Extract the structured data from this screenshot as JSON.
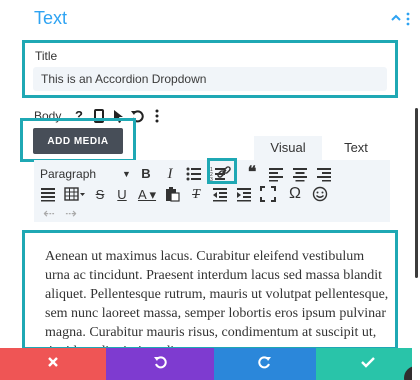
{
  "section": {
    "title": "Text"
  },
  "title_field": {
    "label": "Title",
    "value": "This is an Accordion Dropdown"
  },
  "body_field": {
    "label": "Body",
    "icons": [
      "help-icon",
      "mobile-icon",
      "pointer-icon",
      "reset-icon",
      "more-icon"
    ]
  },
  "add_media": {
    "label": "ADD MEDIA"
  },
  "editor_tabs": {
    "visual": "Visual",
    "text": "Text"
  },
  "toolbar": {
    "paragraph": "Paragraph",
    "row1_icons": [
      "bold-icon",
      "italic-icon",
      "bullet-list-icon",
      "numbered-list-icon",
      "link-icon",
      "blockquote-icon",
      "align-left-icon",
      "align-center-icon",
      "align-right-icon"
    ],
    "row2_icons": [
      "justify-icon",
      "table-icon",
      "strikethrough-icon",
      "underline-icon",
      "text-color-icon",
      "paste-icon",
      "clear-format-icon",
      "outdent-icon",
      "indent-icon",
      "fullscreen-icon",
      "special-char-icon",
      "emoji-icon"
    ],
    "row3_icons": [
      "undo-icon",
      "redo-icon"
    ]
  },
  "content": {
    "text": "Aenean ut maximus lacus. Curabitur eleifend vestibulum urna ac tincidunt. Praesent interdum lacus sed massa blandit aliquet. Pellentesque rutrum, mauris ut volutpat pellentesque, sem nunc laoreet massa, semper lobortis eros ipsum pulvinar magna. Curabitur mauris risus, condimentum at suscipit ut, tincidunt dignissim odio."
  },
  "colors": {
    "accent": "#2ea3f2",
    "highlight_outline": "#1fa8b4",
    "cancel": "#ef5555",
    "undo": "#7e3bd0",
    "redo": "#2b87da",
    "save": "#29c4a9"
  }
}
